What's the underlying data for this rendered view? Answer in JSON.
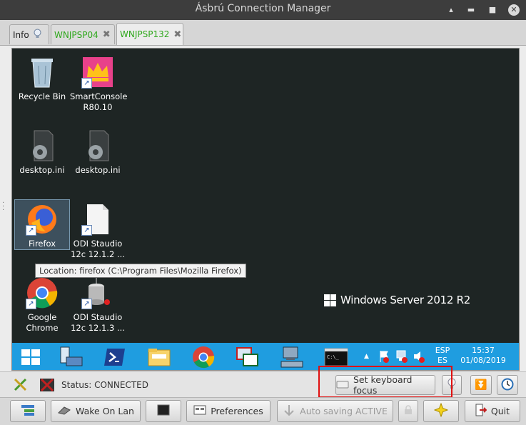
{
  "window": {
    "title": "Ásbrú Connection Manager"
  },
  "tabs": [
    {
      "label": "Info"
    },
    {
      "label": "WNJPSP04"
    },
    {
      "label": "WNJPSP132"
    }
  ],
  "desktop": {
    "icons": [
      {
        "label": "Recycle Bin"
      },
      {
        "label": "SmartConsole R80.10"
      },
      {
        "label": "desktop.ini"
      },
      {
        "label": "desktop.ini"
      },
      {
        "label": "Firefox"
      },
      {
        "label": "ODI Staudio 12c 12.1.2 ..."
      },
      {
        "label": "Google Chrome"
      },
      {
        "label": "ODI Staudio 12c 12.1.3 ..."
      }
    ],
    "tooltip": "Location: firefox (C:\\Program Files\\Mozilla Firefox)",
    "watermark": "Windows Server 2012 R2"
  },
  "taskbar": {
    "lang_top": "ESP",
    "lang_bottom": "ES",
    "time": "15:37",
    "date": "01/08/2019",
    "cmd_text": "C:\\_"
  },
  "statusbar": {
    "status": "Status: CONNECTED",
    "keyboard_focus_label": "Set keyboard focus"
  },
  "bottombar": {
    "wake_on_lan": "Wake On Lan",
    "preferences": "Preferences",
    "autosave": "Auto saving ACTIVE",
    "quit": "Quit"
  }
}
